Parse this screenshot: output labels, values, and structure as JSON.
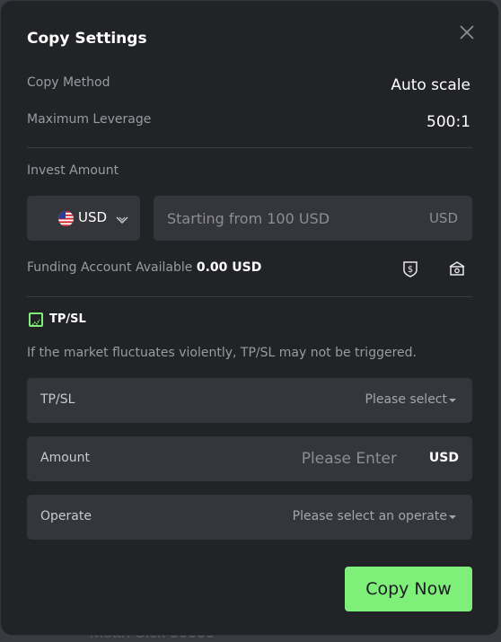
{
  "background": {
    "peek_text": "Mean Sick 50000"
  },
  "modal": {
    "title": "Copy Settings",
    "copy_method": {
      "label": "Copy Method",
      "value": "Auto scale"
    },
    "max_leverage": {
      "label": "Maximum Leverage",
      "value": "500:1"
    },
    "invest_amount": {
      "label": "Invest Amount",
      "currency": "USD",
      "input_placeholder": "Starting from 100 USD",
      "input_unit": "USD"
    },
    "funding": {
      "label": "Funding Account Available",
      "value": "0.00 USD"
    },
    "tpsl": {
      "checkbox_label": "TP/SL",
      "checked": true,
      "warning": "If the market fluctuates violently, TP/SL may not be triggered.",
      "tpsl_field": {
        "label": "TP/SL",
        "placeholder": "Please select"
      },
      "amount_field": {
        "label": "Amount",
        "placeholder": "Please Enter",
        "unit": "USD"
      },
      "operate_field": {
        "label": "Operate",
        "placeholder": "Please select an operate"
      }
    },
    "submit_label": "Copy Now"
  },
  "colors": {
    "accent": "#7ef07a",
    "modal_bg": "#222327",
    "field_bg": "#35363c"
  },
  "icons": [
    "close-icon",
    "us-flag-icon",
    "chevron-down-icon",
    "dollar-shield-icon",
    "bank-icon",
    "checkbox-check-icon",
    "caret-down-icon"
  ]
}
